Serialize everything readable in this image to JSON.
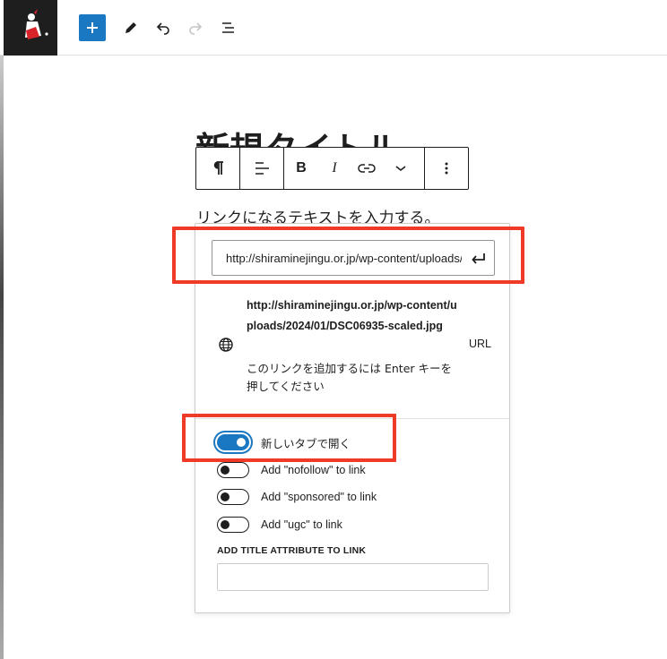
{
  "topbar": {
    "logo_icon": "site-logo-icon",
    "buttons": [
      {
        "name": "add-block-button",
        "icon": "plus-icon"
      },
      {
        "name": "tools-button",
        "icon": "pencil-icon"
      },
      {
        "name": "undo-button",
        "icon": "undo-icon"
      },
      {
        "name": "redo-button",
        "icon": "redo-icon"
      },
      {
        "name": "document-overview-button",
        "icon": "list-view-icon"
      }
    ],
    "accent_color": "#1a78c2"
  },
  "editor": {
    "post_title": "新規タイトル",
    "paragraph_text": "リンクになるテキストを入力する。"
  },
  "block_toolbar": {
    "buttons": [
      "paragraph-icon",
      "align-left-icon",
      "bold-icon",
      "italic-icon",
      "link-icon",
      "chevron-down-icon",
      "more-options-icon"
    ],
    "bold_label": "B",
    "italic_label": "I"
  },
  "link_popover": {
    "url_input_value": "http://shiraminejingu.or.jp/wp-content/uploads/2024/01/DSC06935-scaled.jpg",
    "suggestion": {
      "url": "http://shiraminejingu.or.jp/wp-content/uploads/2024/01/DSC06935-scaled.jpg",
      "hint": "このリンクを追加するには Enter キーを押してください",
      "type": "URL"
    },
    "options": [
      {
        "label": "新しいタブで開く",
        "checked": true
      },
      {
        "label": "Add \"nofollow\" to link",
        "checked": false
      },
      {
        "label": "Add \"sponsored\" to link",
        "checked": false
      },
      {
        "label": "Add \"ugc\" to link",
        "checked": false
      }
    ],
    "title_attribute_label": "ADD TITLE ATTRIBUTE TO LINK",
    "title_attribute_value": ""
  },
  "annotation_color": "#ee3a27"
}
